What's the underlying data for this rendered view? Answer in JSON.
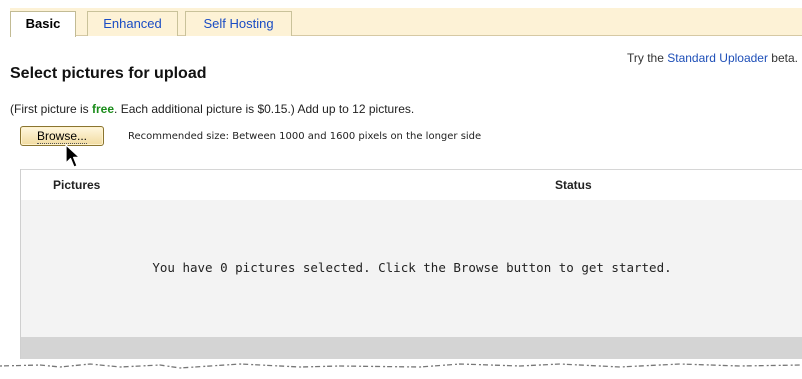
{
  "tabs": [
    {
      "label": "Basic",
      "active": true
    },
    {
      "label": "Enhanced",
      "active": false
    },
    {
      "label": "Self Hosting",
      "active": false
    }
  ],
  "promo": {
    "prefix": "Try the ",
    "link": "Standard Uploader",
    "suffix": " beta."
  },
  "title": "Select pictures for upload",
  "pricing": {
    "before": "(First picture is ",
    "free": "free",
    "after": ". Each additional picture is $0.15.) Add up to 12 pictures."
  },
  "browse_label": "Browse...",
  "recommendation": "Recommended size: Between 1000 and 1600 pixels on the longer side",
  "table": {
    "headers": [
      "Pictures",
      "Status"
    ],
    "empty_message": "You have 0 pictures selected. Click the Browse button to get started."
  },
  "colors": {
    "tab_bar": "#fdf2d6",
    "link": "#1e4fb8",
    "free": "#1a8c1a",
    "table_body": "#f3f3f3",
    "table_footer": "#d4d4d4"
  }
}
